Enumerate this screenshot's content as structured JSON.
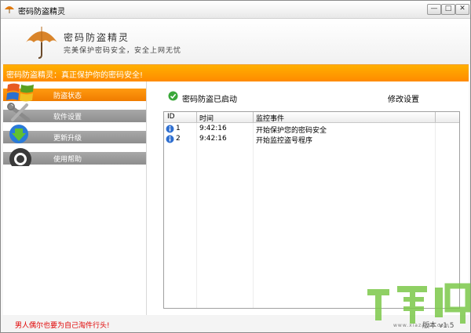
{
  "window": {
    "title": "密码防盗精灵",
    "min_glyph": "—",
    "max_glyph": "□",
    "close_glyph": "✕"
  },
  "header": {
    "title": "密码防盗精灵",
    "slogan": "完美保护密码安全，安全上网无忧"
  },
  "banner": {
    "text": "密码防盗精灵：真正保护你的密码安全!"
  },
  "sidebar": {
    "items": [
      {
        "label": "防盗状态",
        "active": true,
        "icon": "windows-logo-icon"
      },
      {
        "label": "软件设置",
        "active": false,
        "icon": "tools-icon"
      },
      {
        "label": "更新升级",
        "active": false,
        "icon": "download-arrow-icon"
      },
      {
        "label": "使用帮助",
        "active": false,
        "icon": "help-lifebuoy-icon"
      }
    ]
  },
  "main": {
    "status_text": "密码防盗已启动",
    "modify_settings_label": "修改设置",
    "table": {
      "headers": [
        "ID",
        "时间",
        "监控事件"
      ],
      "rows": [
        {
          "id": "1",
          "time": "9:42:16",
          "event": "开始保护您的密码安全",
          "icon": "info-icon"
        },
        {
          "id": "2",
          "time": "9:42:16",
          "event": "开始监控盗号程序",
          "icon": "info-icon"
        }
      ]
    }
  },
  "footer": {
    "tagline": "男人偶尔也要为自己淘件行头!",
    "version": "版本 v1.5"
  },
  "watermark": {
    "text": "www.xiazaiba.com"
  },
  "colors": {
    "accent": "#ff8a00",
    "banner": "#ffa000",
    "nav_inactive": "#9a9a9a",
    "tagline": "#e00000"
  }
}
